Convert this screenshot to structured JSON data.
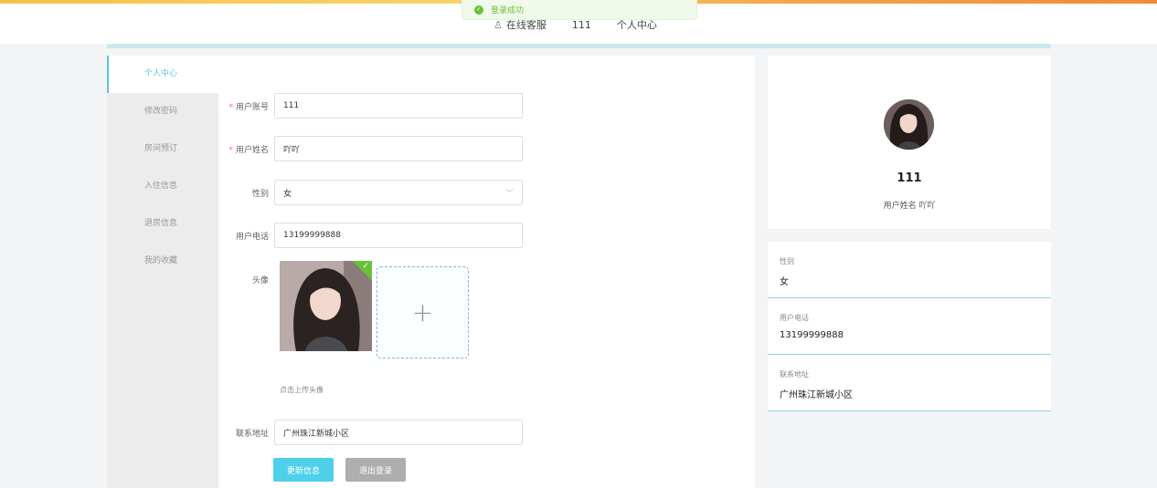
{
  "toast": {
    "text": "登录成功"
  },
  "nav": {
    "items": [
      {
        "label": "在线客服",
        "icon": "user-icon"
      },
      {
        "label": "111"
      },
      {
        "label": "个人中心"
      }
    ]
  },
  "sidebar": {
    "items": [
      {
        "label": "个人中心",
        "active": true
      },
      {
        "label": "修改密码"
      },
      {
        "label": "房间预订"
      },
      {
        "label": "入住信息"
      },
      {
        "label": "退房信息"
      },
      {
        "label": "我的收藏"
      }
    ]
  },
  "form": {
    "account": {
      "label": "用户账号",
      "value": "111",
      "required": true
    },
    "name": {
      "label": "用户姓名",
      "value": "吖吖",
      "required": true
    },
    "gender": {
      "label": "性别",
      "value": "女"
    },
    "phone": {
      "label": "用户电话",
      "value": "13199999888"
    },
    "avatar": {
      "label": "头像",
      "upload_icon": "+",
      "tip": "点击上传头像"
    },
    "address": {
      "label": "联系地址",
      "value": "广州珠江新城小区"
    },
    "update_label": "更新信息",
    "logout_label": "退出登录"
  },
  "profile": {
    "name": "111",
    "subtitle": "用户姓名 吖吖"
  },
  "info": [
    {
      "label": "性别",
      "value": "女"
    },
    {
      "label": "用户电话",
      "value": "13199999888"
    },
    {
      "label": "联系地址",
      "value": "广州珠江新城小区"
    }
  ],
  "colors": {
    "accent": "#5bc6dc",
    "primary_button": "#4fd0ea",
    "success": "#67c23a"
  }
}
